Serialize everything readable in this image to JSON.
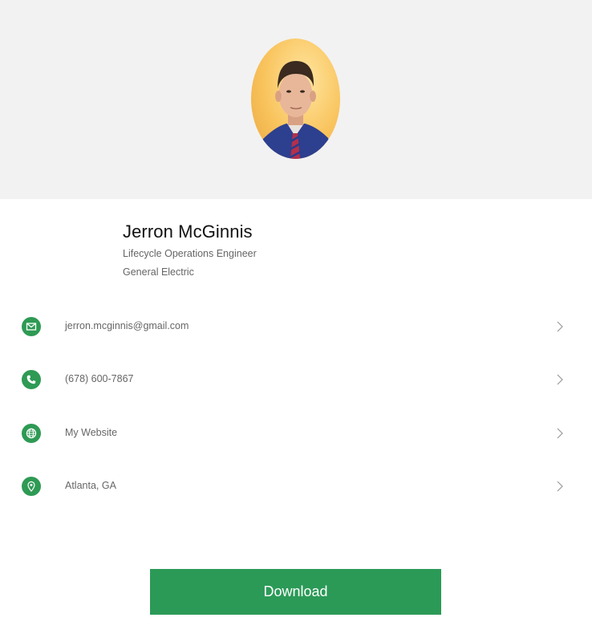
{
  "profile": {
    "name": "Jerron McGinnis",
    "title": "Lifecycle Operations Engineer",
    "company": "General Electric"
  },
  "contacts": [
    {
      "icon": "email-icon",
      "label": "jerron.mcginnis@gmail.com"
    },
    {
      "icon": "phone-icon",
      "label": "(678) 600-7867"
    },
    {
      "icon": "globe-icon",
      "label": "My Website"
    },
    {
      "icon": "location-pin-icon",
      "label": "Atlanta, GA"
    }
  ],
  "actions": {
    "download_label": "Download"
  },
  "colors": {
    "accent": "#2b9a57",
    "header_bg": "#f2f2f2"
  }
}
